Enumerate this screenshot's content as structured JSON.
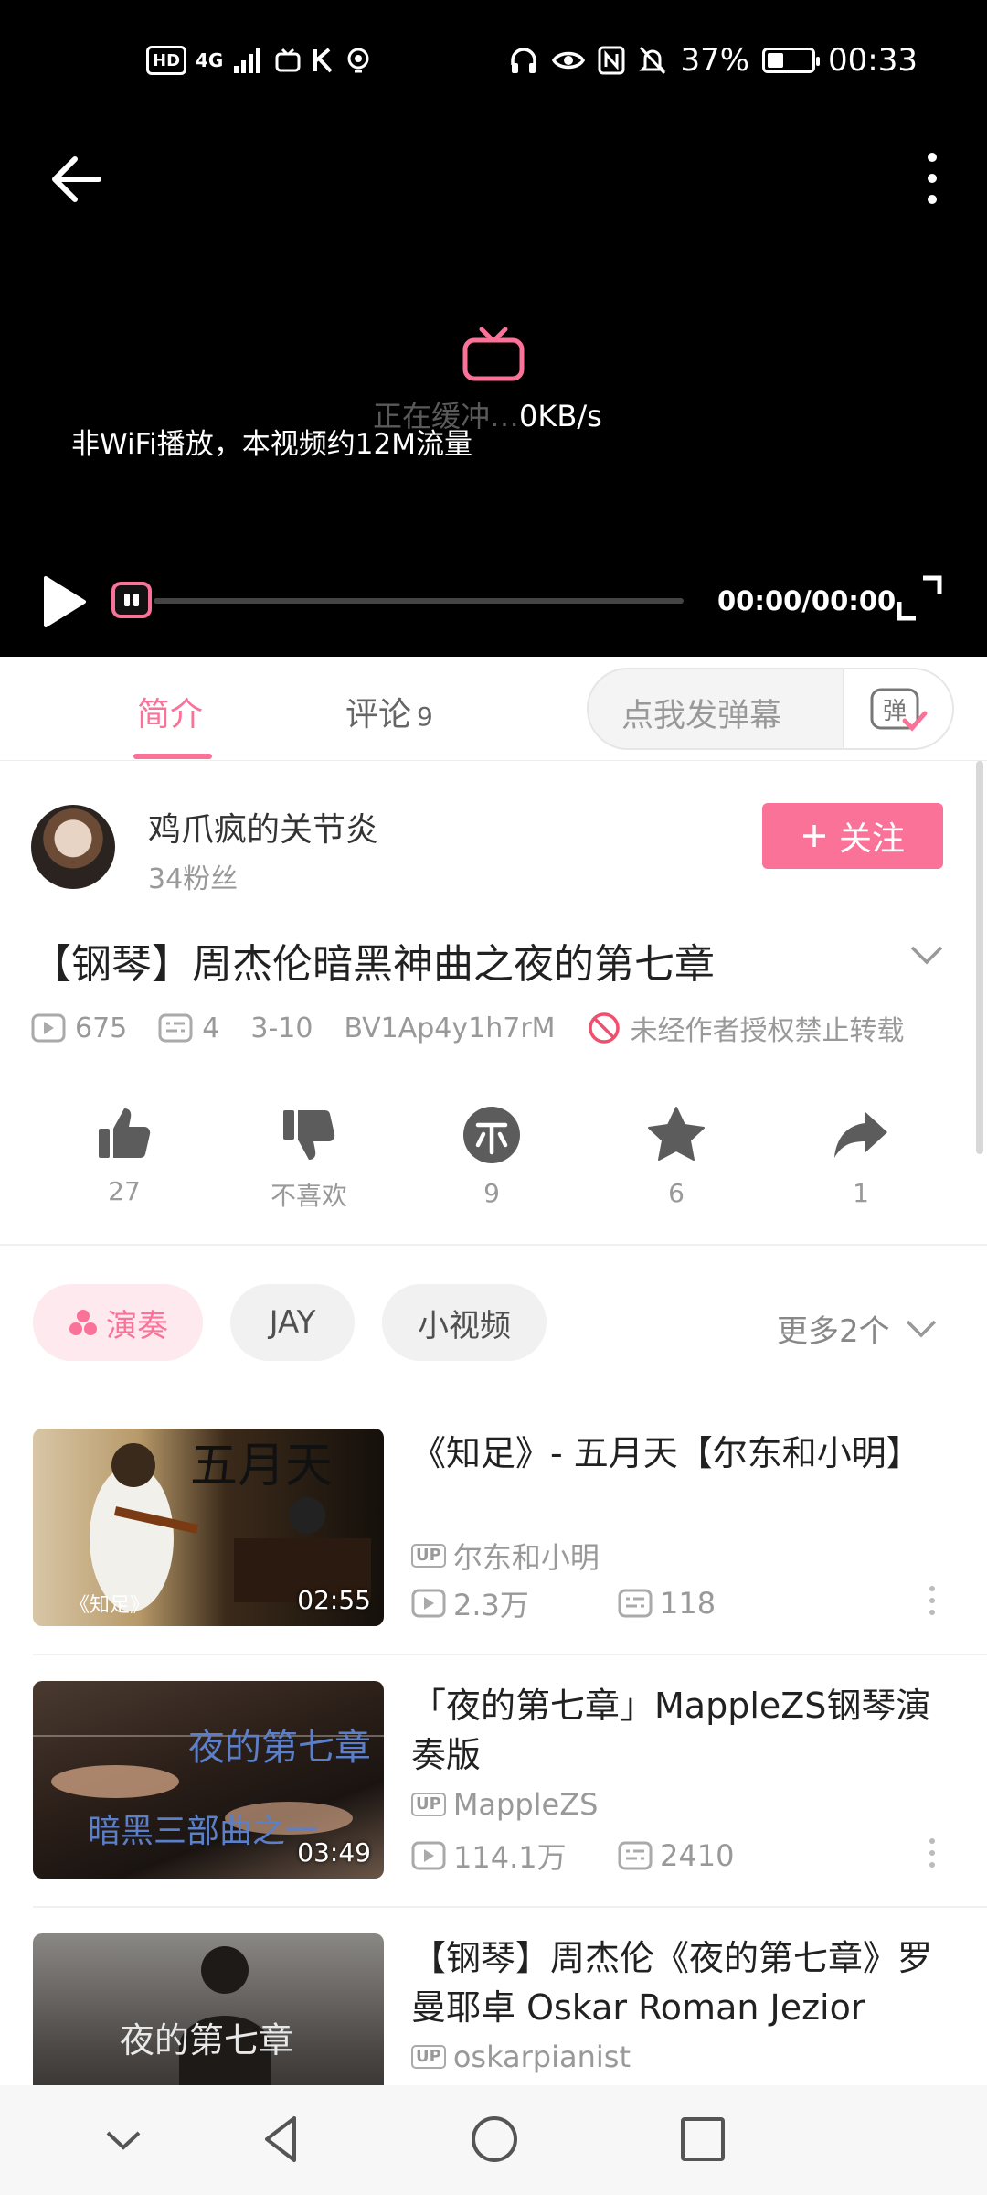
{
  "status_bar": {
    "left_chips": [
      "HD",
      "4G"
    ],
    "battery": "37%",
    "battery_level": 0.37,
    "time": "00:33"
  },
  "player": {
    "buffer_text_dim": "正在缓冲…",
    "buffer_text_rate": "0KB/s",
    "wifi_notice": "非WiFi播放，本视频约12M流量",
    "time": "00:00/00:00",
    "progress": 0
  },
  "tabs": {
    "intro": "简介",
    "comments": "评论",
    "comments_count": "9",
    "danmaku_placeholder": "点我发弹幕",
    "danmaku_btn": "弹"
  },
  "uploader": {
    "name": "鸡爪疯的关节炎",
    "fans": "34粉丝",
    "follow": "关注"
  },
  "video": {
    "title": "【钢琴】周杰伦暗黑神曲之夜的第七章",
    "views": "675",
    "danmaku": "4",
    "date": "3-10",
    "bvid": "BV1Ap4y1h7rM",
    "copyright": "未经作者授权禁止转载"
  },
  "actions": {
    "like": "27",
    "dislike": "不喜欢",
    "coin": "9",
    "favorite": "6",
    "share": "1"
  },
  "tags": {
    "items": [
      "演奏",
      "JAY",
      "小视频"
    ],
    "more": "更多2个"
  },
  "related": [
    {
      "title": "《知足》- 五月天【尔东和小明】",
      "up": "尔东和小明",
      "views": "2.3万",
      "danmaku": "118",
      "duration": "02:55",
      "thumb_text": "五月天",
      "thumb_subtext": "《知足》"
    },
    {
      "title": "「夜的第七章」MappleZS钢琴演奏版",
      "up": "MappleZS",
      "views": "114.1万",
      "danmaku": "2410",
      "duration": "03:49",
      "thumb_text": "夜的第七章",
      "thumb_subtext": "暗黑三部曲之一"
    },
    {
      "title": "【钢琴】周杰伦《夜的第七章》罗曼耶卓 Oskar Roman Jezior",
      "up": "oskarpianist",
      "thumb_text": "夜的第七章"
    }
  ],
  "colors": {
    "brand_pink": "#fb7299",
    "text_primary": "#212121",
    "text_secondary": "#999999"
  }
}
